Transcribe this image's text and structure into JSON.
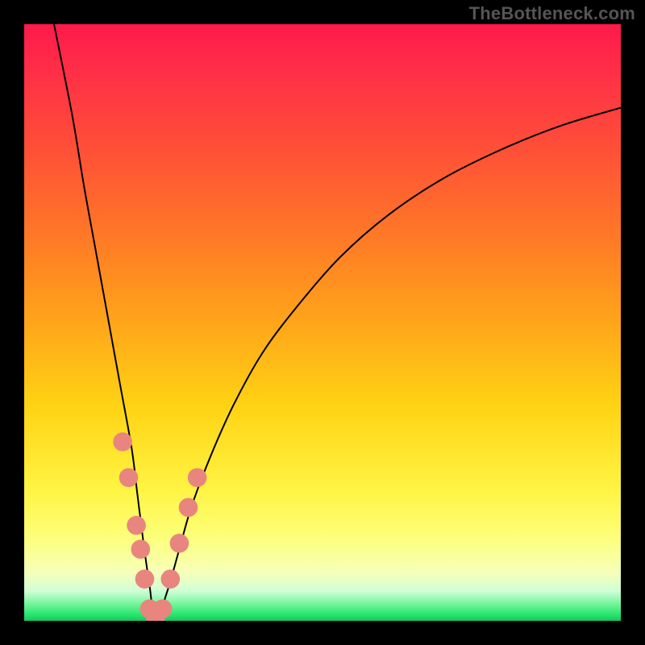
{
  "watermark": "TheBottleneck.com",
  "colors": {
    "background": "#000000",
    "curve_stroke": "#000000",
    "point_fill": "#e9857f",
    "gradient_top": "#ff1a4b",
    "gradient_mid": "#ffd313",
    "gradient_bottom": "#14c95b"
  },
  "chart_data": {
    "type": "line",
    "title": "",
    "xlabel": "",
    "ylabel": "",
    "xlim": [
      0,
      100
    ],
    "ylim": [
      0,
      100
    ],
    "notes": "Bottleneck curve: y ≈ 0 at the optimum x, rising sharply on both sides (steeper on the left). Values estimated from pixel positions; axes have no tick labels in the source image.",
    "optimum_x": 22,
    "series": [
      {
        "name": "bottleneck-curve",
        "x": [
          5,
          8,
          10,
          12,
          14,
          16,
          18,
          19,
          20,
          21,
          22,
          24,
          26,
          28,
          31,
          35,
          40,
          46,
          53,
          61,
          70,
          80,
          90,
          100
        ],
        "y": [
          100,
          85,
          73,
          62,
          51,
          40,
          29,
          21,
          13,
          6,
          0,
          5,
          12,
          19,
          27,
          36,
          45,
          53,
          61,
          68,
          74,
          79,
          83,
          86
        ]
      }
    ],
    "points": [
      {
        "name": "pt-left-1",
        "x": 16.5,
        "y": 30,
        "r": 1.6
      },
      {
        "name": "pt-left-2",
        "x": 17.5,
        "y": 24,
        "r": 1.6
      },
      {
        "name": "pt-left-3",
        "x": 18.8,
        "y": 16,
        "r": 1.6
      },
      {
        "name": "pt-left-4",
        "x": 19.5,
        "y": 12,
        "r": 1.6
      },
      {
        "name": "pt-left-5",
        "x": 20.2,
        "y": 7,
        "r": 1.6
      },
      {
        "name": "pt-bottom-1",
        "x": 21.0,
        "y": 2,
        "r": 1.6
      },
      {
        "name": "pt-bottom-2",
        "x": 22.0,
        "y": 0,
        "r": 1.6
      },
      {
        "name": "pt-bottom-3",
        "x": 23.2,
        "y": 2,
        "r": 1.6
      },
      {
        "name": "pt-right-1",
        "x": 24.5,
        "y": 7,
        "r": 1.6
      },
      {
        "name": "pt-right-2",
        "x": 26.0,
        "y": 13,
        "r": 1.6
      },
      {
        "name": "pt-right-3",
        "x": 27.5,
        "y": 19,
        "r": 1.6
      },
      {
        "name": "pt-right-4",
        "x": 29.0,
        "y": 24,
        "r": 1.6
      }
    ]
  }
}
